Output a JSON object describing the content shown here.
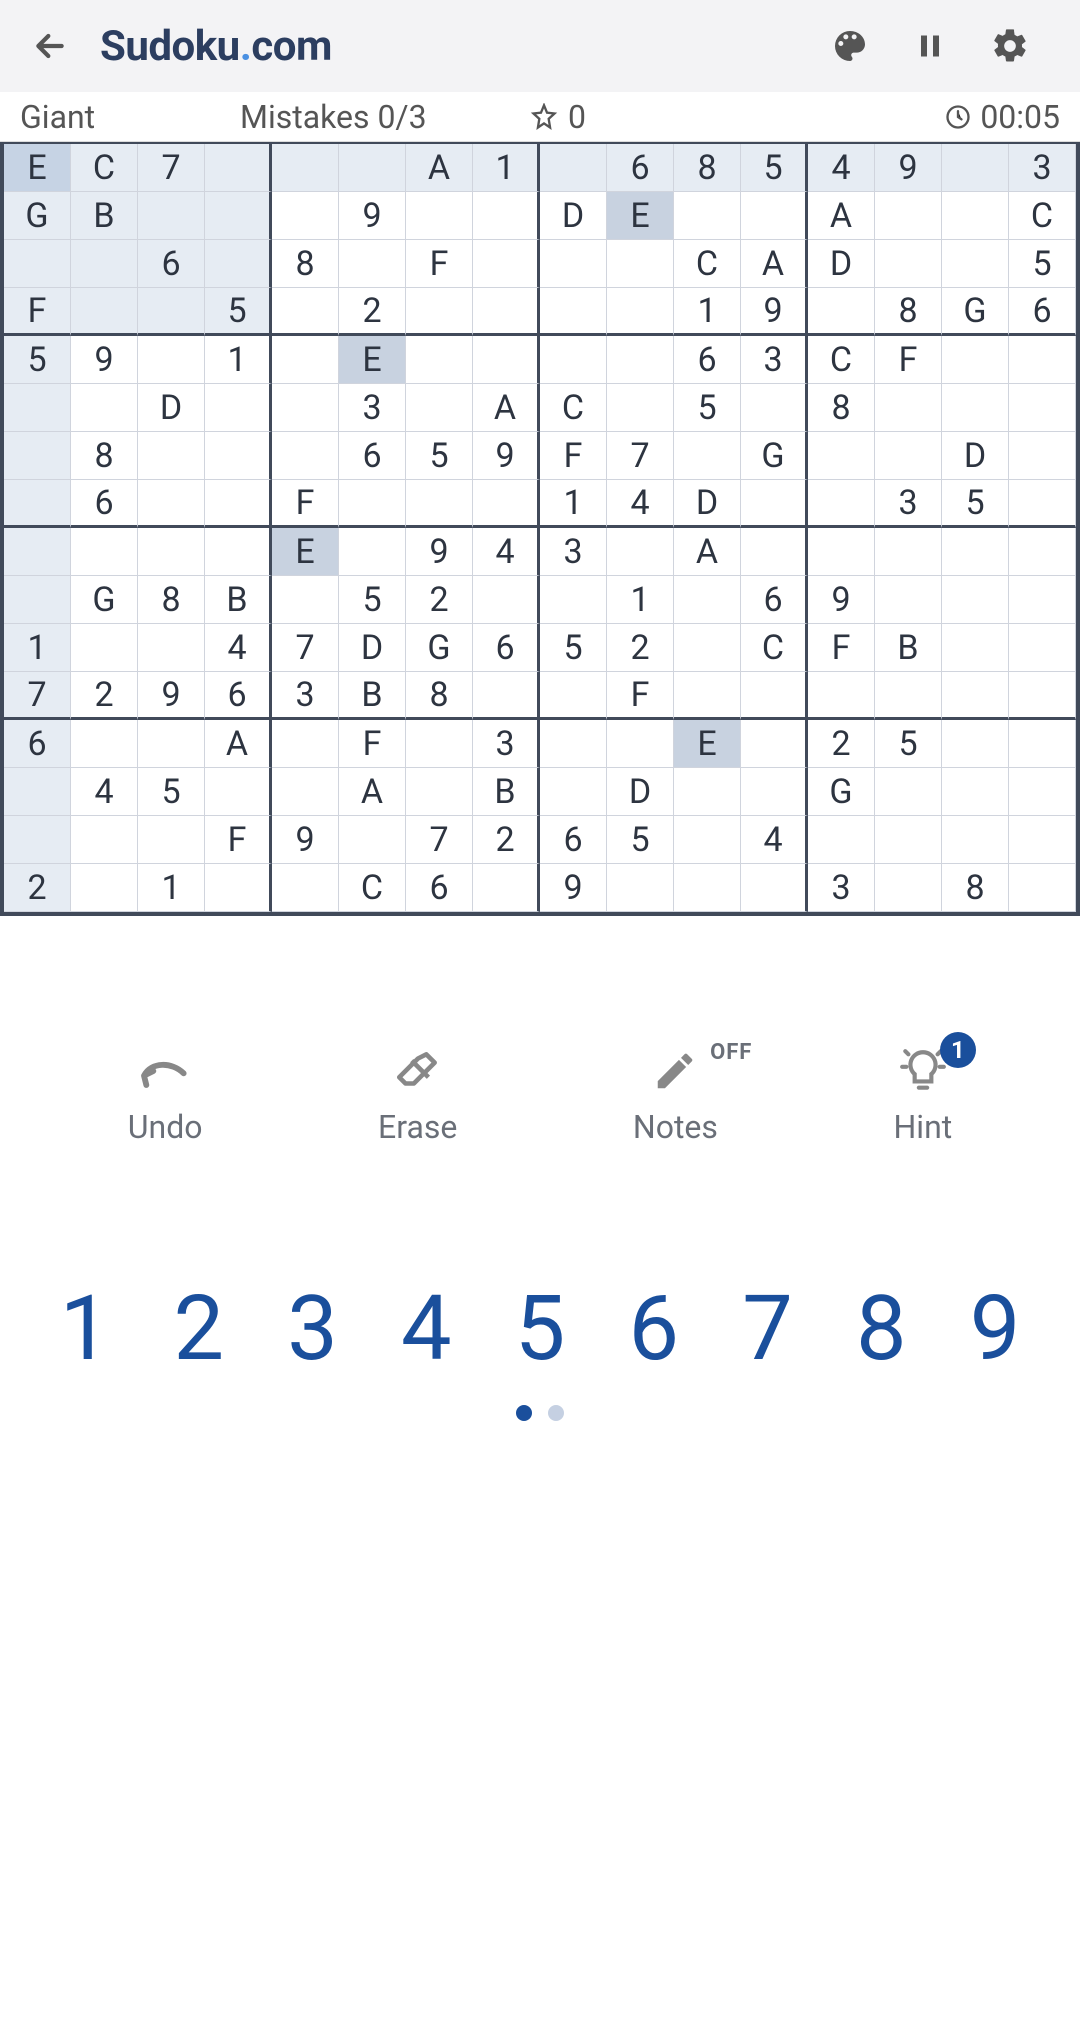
{
  "header": {
    "title_a": "Sudoku",
    "title_b": ".",
    "title_c": "com"
  },
  "info": {
    "difficulty": "Giant",
    "mistakes": "Mistakes 0/3",
    "score": "0",
    "time": "00:05"
  },
  "tools": {
    "undo": "Undo",
    "erase": "Erase",
    "notes": "Notes",
    "notes_state": "OFF",
    "hint": "Hint",
    "hint_count": "1"
  },
  "numpad": [
    "1",
    "2",
    "3",
    "4",
    "5",
    "6",
    "7",
    "8",
    "9"
  ],
  "board": {
    "size": 16,
    "selected": [
      0,
      0
    ],
    "rows": [
      [
        "E",
        "C",
        "7",
        "",
        "",
        "",
        "A",
        "1",
        "",
        "6",
        "8",
        "5",
        "4",
        "9",
        "",
        "3"
      ],
      [
        "G",
        "B",
        "",
        "",
        "",
        "9",
        "",
        "",
        "D",
        "E",
        "",
        "",
        "A",
        "",
        "",
        "C"
      ],
      [
        "",
        "",
        "6",
        "",
        "8",
        "",
        "F",
        "",
        "",
        "",
        "C",
        "A",
        "D",
        "",
        "",
        "5"
      ],
      [
        "F",
        "",
        "",
        "5",
        "",
        "2",
        "",
        "",
        "",
        "",
        "1",
        "9",
        "",
        "8",
        "G",
        "6"
      ],
      [
        "5",
        "9",
        "",
        "1",
        "",
        "E",
        "",
        "",
        "",
        "",
        "6",
        "3",
        "C",
        "F",
        "",
        ""
      ],
      [
        "",
        "",
        "D",
        "",
        "",
        "3",
        "",
        "A",
        "C",
        "",
        "5",
        "",
        "8",
        "",
        "",
        ""
      ],
      [
        "",
        "8",
        "",
        "",
        "",
        "6",
        "5",
        "9",
        "F",
        "7",
        "",
        "G",
        "",
        "",
        "D",
        ""
      ],
      [
        "",
        "6",
        "",
        "",
        "F",
        "",
        "",
        "",
        "1",
        "4",
        "D",
        "",
        "",
        "3",
        "5",
        ""
      ],
      [
        "",
        "",
        "",
        "",
        "E",
        "",
        "9",
        "4",
        "3",
        "",
        "A",
        "",
        "",
        "",
        "",
        ""
      ],
      [
        "",
        "G",
        "8",
        "B",
        "",
        "5",
        "2",
        "",
        "",
        "1",
        "",
        "6",
        "9",
        "",
        "",
        ""
      ],
      [
        "1",
        "",
        "",
        "4",
        "7",
        "D",
        "G",
        "6",
        "5",
        "2",
        "",
        "C",
        "F",
        "B",
        "",
        ""
      ],
      [
        "7",
        "2",
        "9",
        "6",
        "3",
        "B",
        "8",
        "",
        "",
        "F",
        "",
        "",
        "",
        "",
        "",
        ""
      ],
      [
        "6",
        "",
        "",
        "A",
        "",
        "F",
        "",
        "3",
        "",
        "",
        "E",
        "",
        "2",
        "5",
        "",
        ""
      ],
      [
        "",
        "4",
        "5",
        "",
        "",
        "A",
        "",
        "B",
        "",
        "D",
        "",
        "",
        "G",
        "",
        "",
        ""
      ],
      [
        "",
        "",
        "",
        "F",
        "9",
        "",
        "7",
        "2",
        "6",
        "5",
        "",
        "4",
        "",
        "",
        "",
        ""
      ],
      [
        "2",
        "",
        "1",
        "",
        "",
        "C",
        "6",
        "",
        "9",
        "",
        "",
        "",
        "3",
        "",
        "8",
        ""
      ]
    ]
  }
}
